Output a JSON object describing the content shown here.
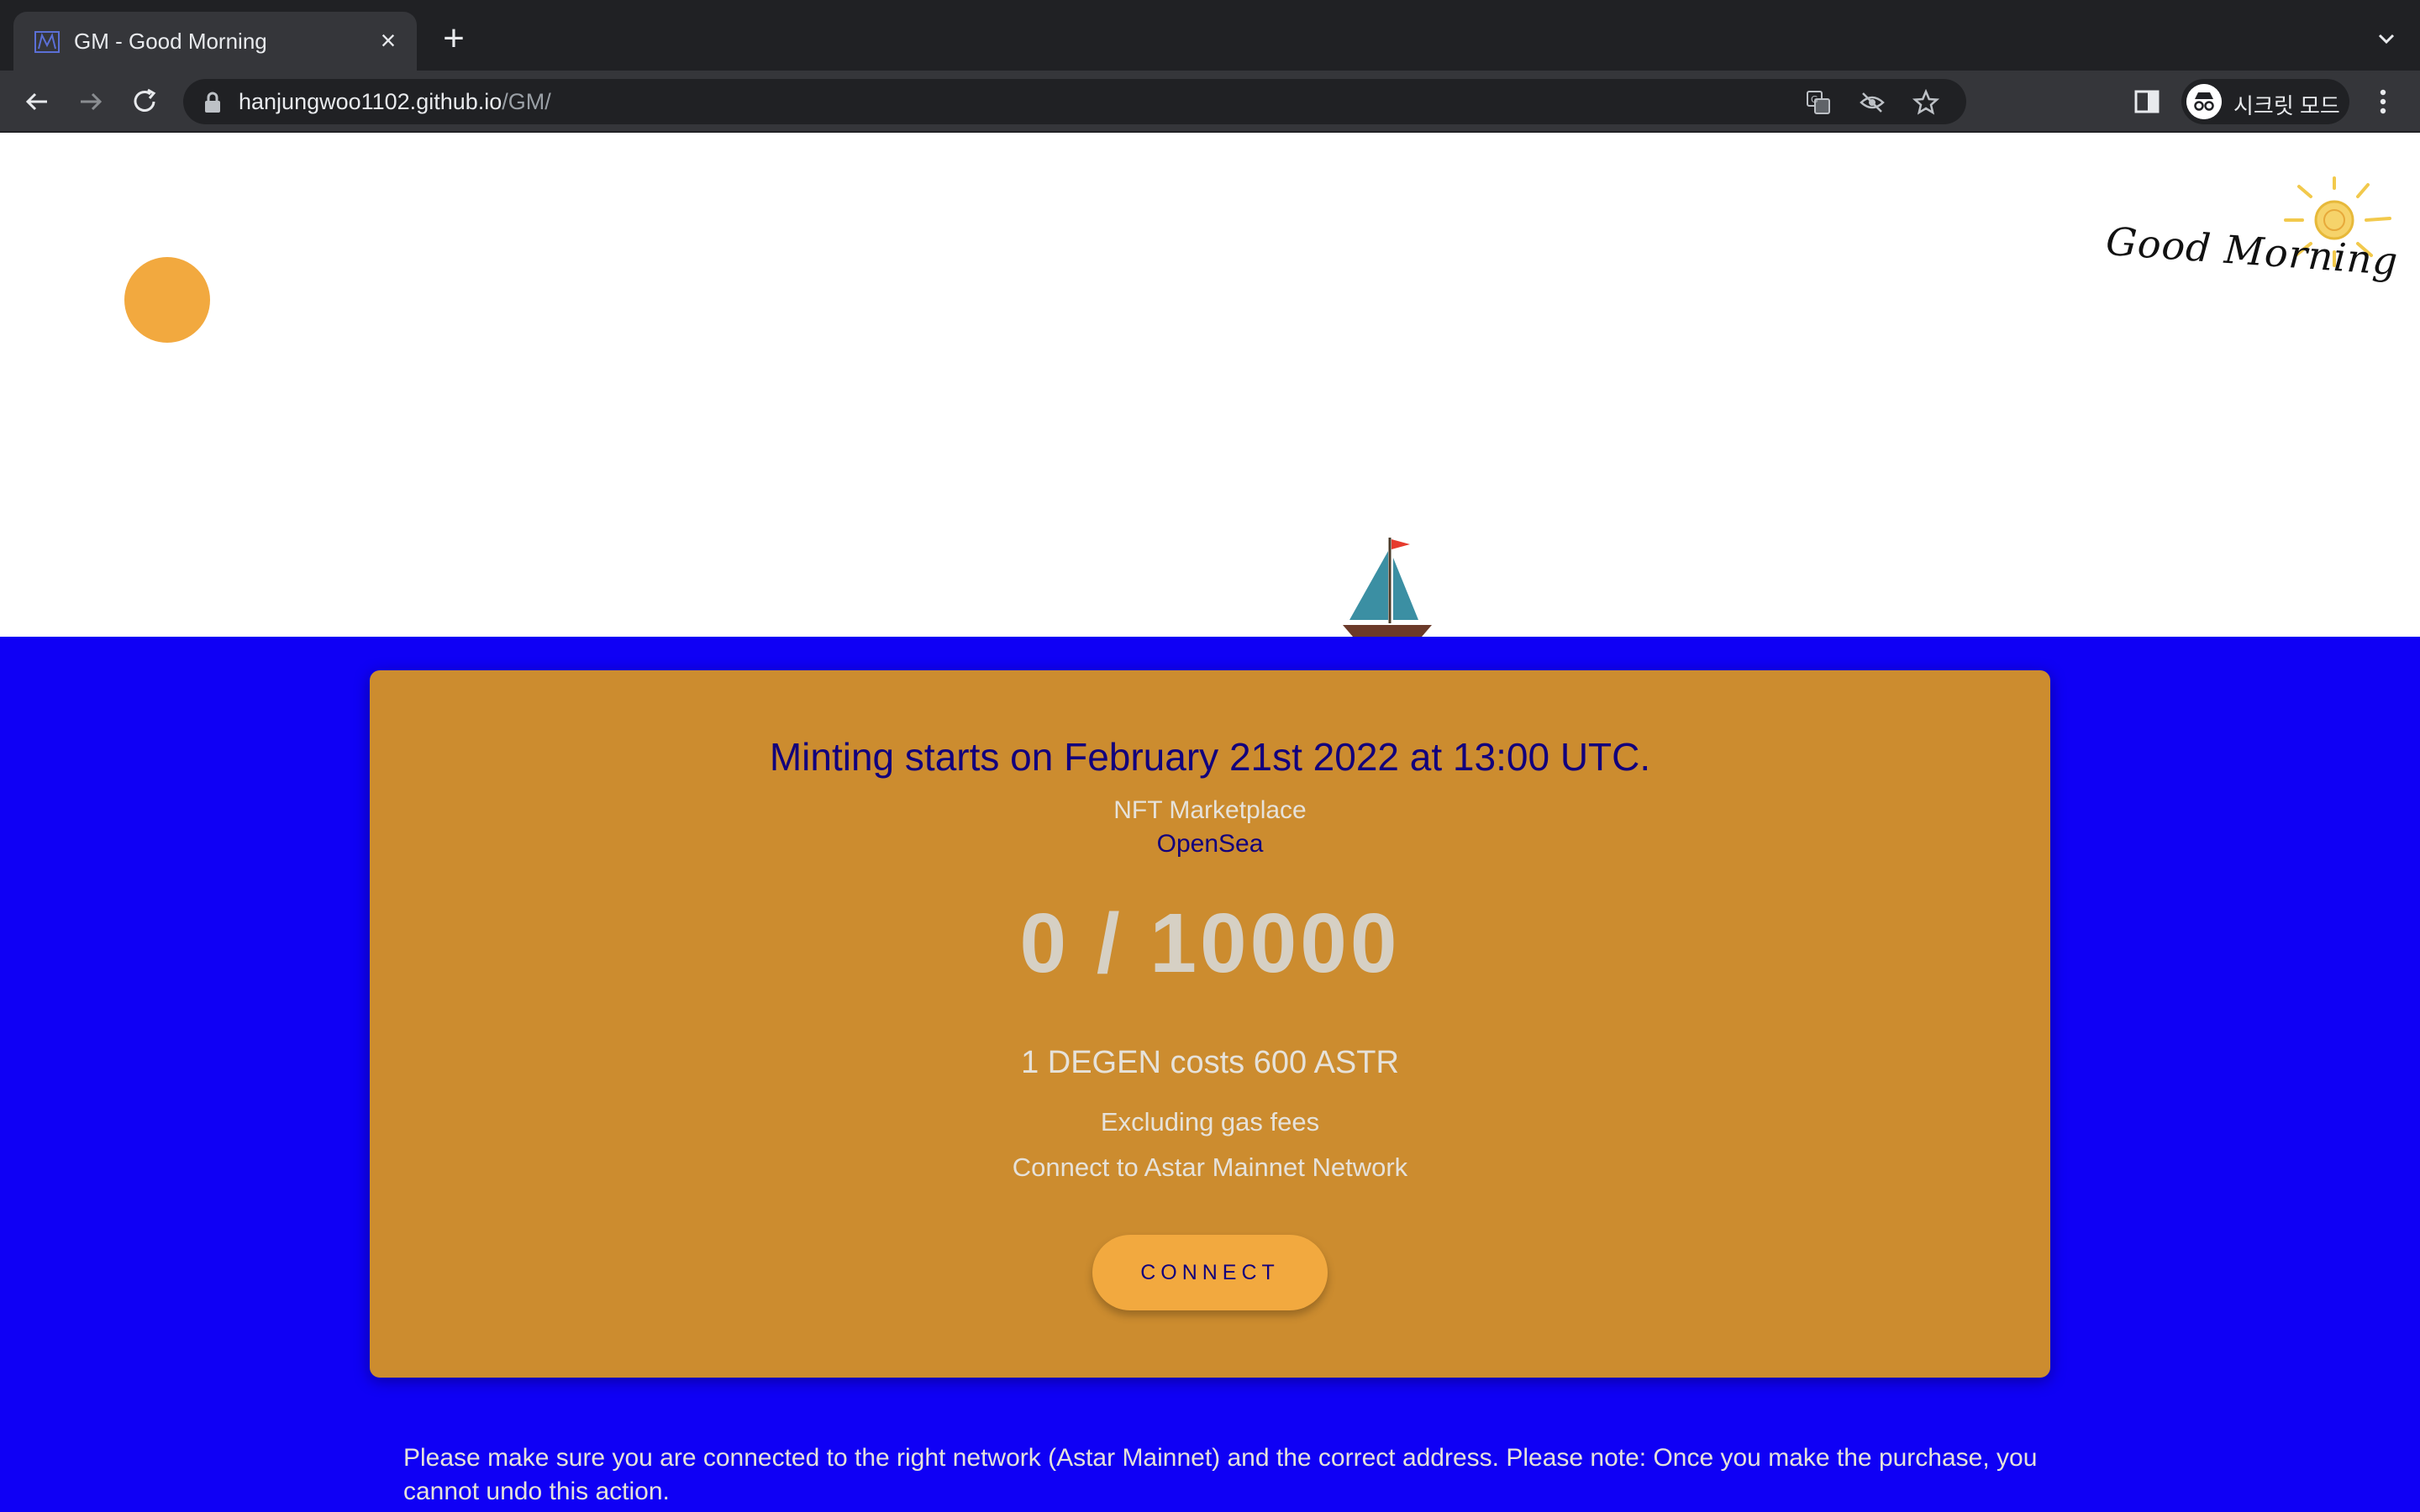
{
  "browser": {
    "tab_title": "GM - Good Morning",
    "url_host": "hanjungwoo1102.github.io",
    "url_path": "/GM/",
    "profile_label": "시크릿 모드",
    "icons": [
      "favicon",
      "close-icon",
      "plus-icon",
      "chevron-down-icon",
      "back-arrow-icon",
      "forward-arrow-icon",
      "reload-icon",
      "lock-icon",
      "translate-icon",
      "eye-off-icon",
      "star-icon",
      "side-panel-icon",
      "incognito-icon",
      "kebab-menu-icon"
    ]
  },
  "hero": {
    "logo_text": "Good Morning",
    "colors": {
      "sun": "#f2a93f",
      "sea": "#0f00f5",
      "card": "#cc8c2f",
      "accent_text": "#12007c"
    }
  },
  "mint": {
    "headline": "Minting starts on February 21st 2022 at 13:00 UTC.",
    "marketplace_label": "NFT Marketplace",
    "marketplace_link": "OpenSea",
    "counter": "0 / 10000",
    "price": "1 DEGEN costs 600 ASTR",
    "gas_note": "Excluding gas fees",
    "network_note": "Connect to Astar Mainnet Network",
    "connect_label": "CONNECT"
  },
  "disclaimer": "Please make sure you are connected to the right network (Astar Mainnet) and the correct address. Please note: Once you make the purchase, you cannot undo this action."
}
